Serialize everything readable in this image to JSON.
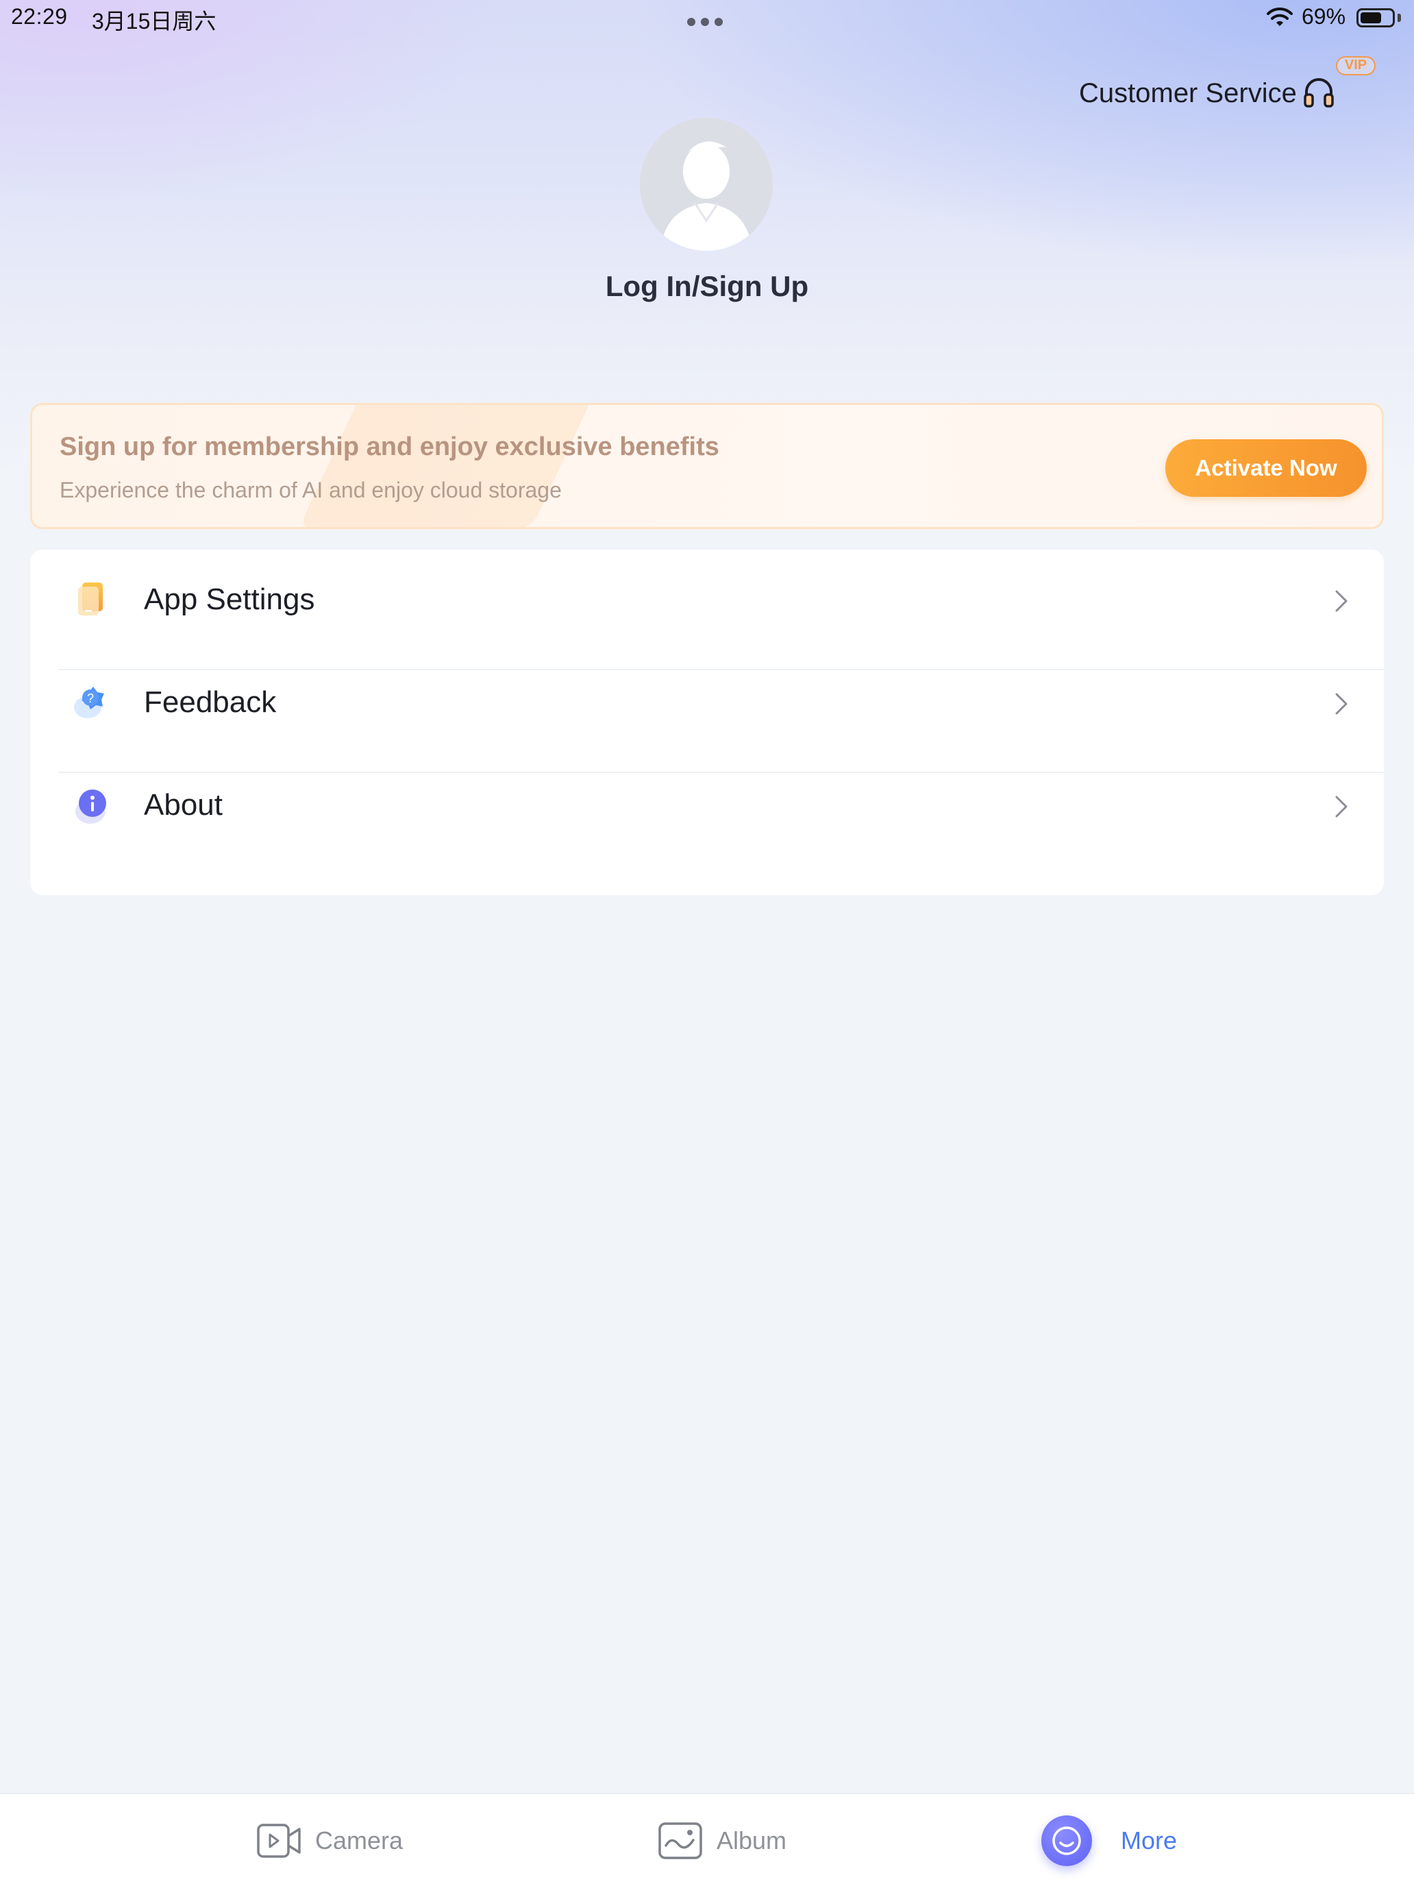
{
  "status_bar": {
    "time": "22:29",
    "date": "3月15日周六",
    "battery_percent": "69%",
    "battery_level": 0.69
  },
  "header": {
    "customer_service_label": "Customer Service",
    "vip_badge": "VIP",
    "login_label": "Log In/Sign Up"
  },
  "banner": {
    "title": "Sign up for membership and enjoy exclusive benefits",
    "subtitle": "Experience the charm of AI and enjoy cloud storage",
    "button_label": "Activate Now"
  },
  "menu": {
    "items": [
      {
        "label": "App Settings",
        "icon": "settings-phone-icon"
      },
      {
        "label": "Feedback",
        "icon": "feedback-question-icon"
      },
      {
        "label": "About",
        "icon": "info-icon"
      }
    ]
  },
  "tab_bar": {
    "tabs": [
      {
        "label": "Camera",
        "icon": "camera-icon",
        "active": false
      },
      {
        "label": "Album",
        "icon": "album-icon",
        "active": false
      },
      {
        "label": "More",
        "icon": "more-face-icon",
        "active": true
      }
    ]
  },
  "colors": {
    "accent_orange": "#f6922c",
    "active_tab_blue": "#4b7cf1",
    "more_icon_purple": "#5d62f5"
  }
}
